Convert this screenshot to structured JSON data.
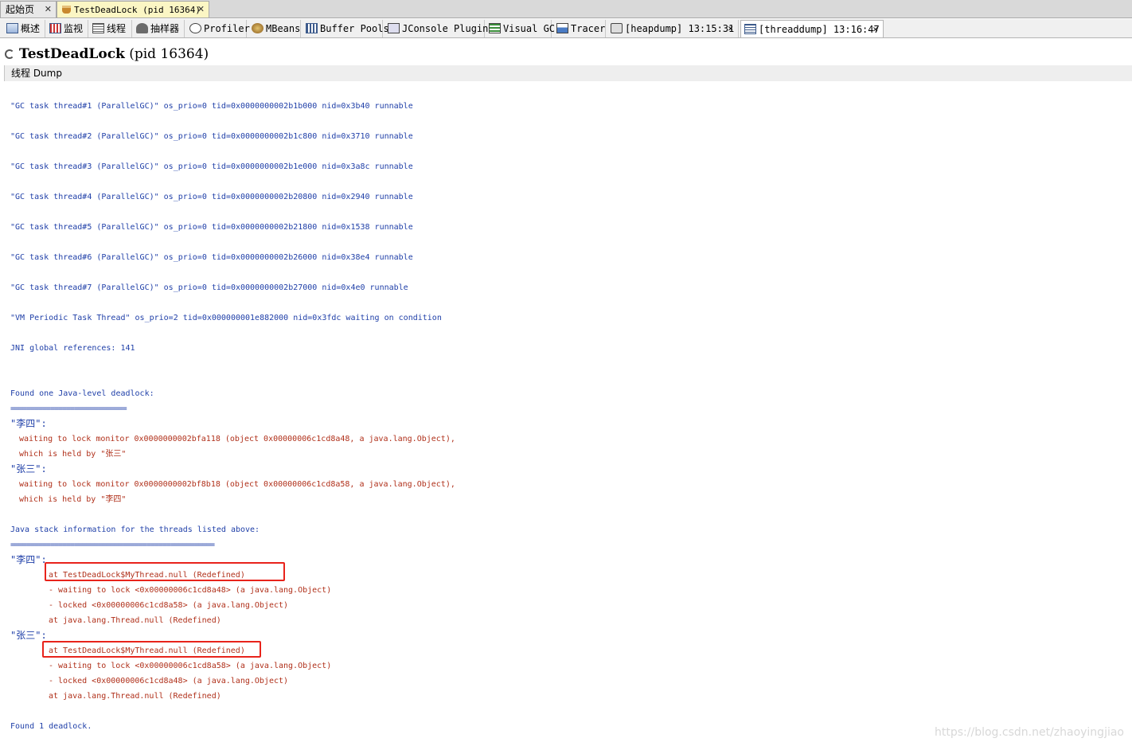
{
  "doc_tabs": [
    {
      "label": "起始页"
    },
    {
      "label": "TestDeadLock (pid 16364)"
    }
  ],
  "tool_tabs": [
    {
      "label": "概述",
      "icon": "overview-icon"
    },
    {
      "label": "监视",
      "icon": "monitor-icon"
    },
    {
      "label": "线程",
      "icon": "threads-icon"
    },
    {
      "label": "抽样器",
      "icon": "sampler-icon"
    },
    {
      "label": "Profiler",
      "icon": "profiler-icon"
    },
    {
      "label": "MBeans",
      "icon": "mbeans-icon"
    },
    {
      "label": "Buffer Pools",
      "icon": "buffer-pools-icon"
    },
    {
      "label": "JConsole Plugins",
      "icon": "jconsole-plugins-icon"
    },
    {
      "label": "Visual GC",
      "icon": "visual-gc-icon"
    },
    {
      "label": "Tracer",
      "icon": "tracer-icon"
    },
    {
      "label": "[heapdump] 13:15:31",
      "icon": "heapdump-icon"
    },
    {
      "label": "[threaddump] 13:16:47",
      "icon": "threaddump-icon"
    }
  ],
  "title": {
    "name": "TestDeadLock",
    "pid": "(pid 16364)"
  },
  "section_header": "线程 Dump",
  "dump_lines": {
    "gc1": "\"GC task thread#1 (ParallelGC)\" os_prio=0 tid=0x0000000002b1b000 nid=0x3b40 runnable",
    "gc2": "\"GC task thread#2 (ParallelGC)\" os_prio=0 tid=0x0000000002b1c800 nid=0x3710 runnable",
    "gc3": "\"GC task thread#3 (ParallelGC)\" os_prio=0 tid=0x0000000002b1e000 nid=0x3a8c runnable",
    "gc4": "\"GC task thread#4 (ParallelGC)\" os_prio=0 tid=0x0000000002b20800 nid=0x2940 runnable",
    "gc5": "\"GC task thread#5 (ParallelGC)\" os_prio=0 tid=0x0000000002b21800 nid=0x1538 runnable",
    "gc6": "\"GC task thread#6 (ParallelGC)\" os_prio=0 tid=0x0000000002b26000 nid=0x38e4 runnable",
    "gc7": "\"GC task thread#7 (ParallelGC)\" os_prio=0 tid=0x0000000002b27000 nid=0x4e0 runnable",
    "vm": "\"VM Periodic Task Thread\" os_prio=2 tid=0x000000001e882000 nid=0x3fdc waiting on condition",
    "jni": "JNI global references: 141",
    "found_one": "Found one Java-level deadlock:",
    "rule1": "=============================",
    "lisi_head": "\"李四\":",
    "lisi_wait": "waiting to lock monitor 0x0000000002bfa118 (object 0x00000006c1cd8a48, a java.lang.Object),",
    "lisi_held": "which is held by \"张三\"",
    "zhangsan_head": "\"张三\":",
    "zhangsan_wait": "waiting to lock monitor 0x0000000002bf8b18 (object 0x00000006c1cd8a58, a java.lang.Object),",
    "zhangsan_held": "which is held by \"李四\"",
    "stack_info": "Java stack information for the threads listed above:",
    "rule2": "===================================================",
    "lisi_head2": "\"李四\":",
    "lisi_s1": "at TestDeadLock$MyThread.null (Redefined)",
    "lisi_s2": "- waiting to lock <0x00000006c1cd8a48> (a java.lang.Object)",
    "lisi_s3": "- locked <0x00000006c1cd8a58> (a java.lang.Object)",
    "lisi_s4": "at java.lang.Thread.null (Redefined)",
    "zhangsan_head2": "\"张三\":",
    "zs_s1": "at TestDeadLock$MyThread.null (Redefined)",
    "zs_s2": "- waiting to lock <0x00000006c1cd8a58> (a java.lang.Object)",
    "zs_s3": "- locked <0x00000006c1cd8a48> (a java.lang.Object)",
    "zs_s4": "at java.lang.Thread.null (Redefined)",
    "found_1": "Found 1 deadlock."
  },
  "watermark": "https://blog.csdn.net/zhaoyingjiao",
  "colors": {
    "dump_text_blue": "#1f3fa8",
    "deadlock_text_red": "#b0301a",
    "highlight_box": "#e8231b",
    "active_doc_tab": "#fbf6c4"
  }
}
